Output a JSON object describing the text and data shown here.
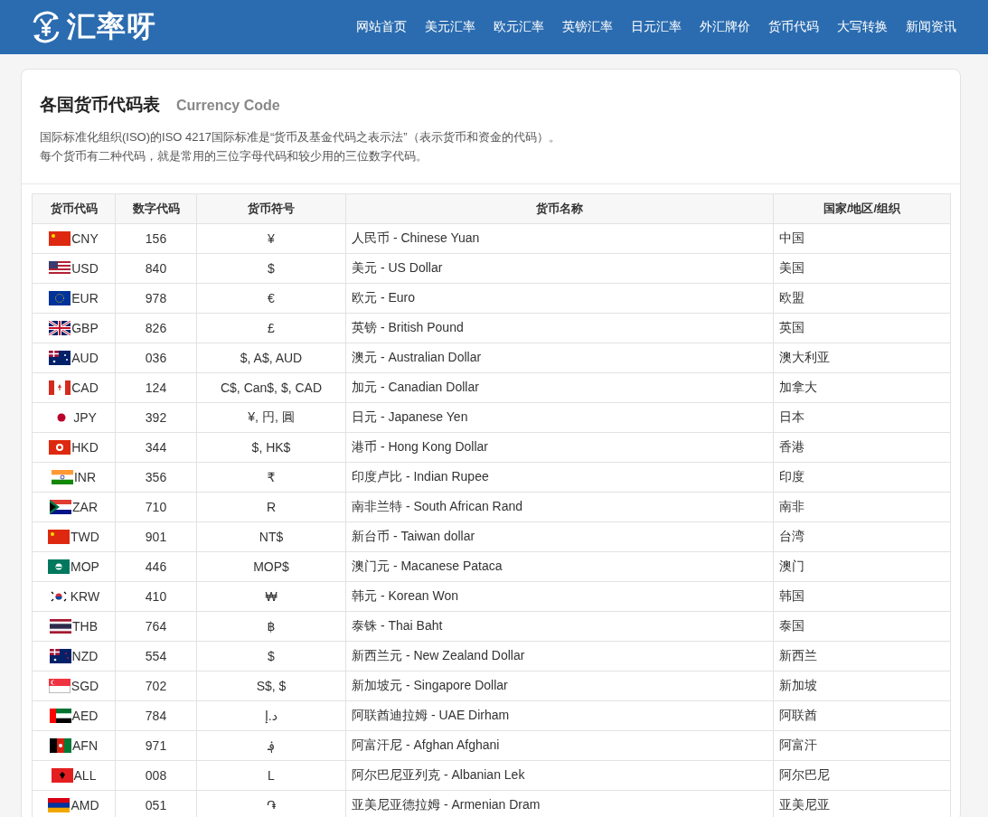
{
  "header": {
    "logo_text": "汇率呀",
    "nav": [
      {
        "label": "网站首页",
        "selected": false
      },
      {
        "label": "美元汇率",
        "selected": false
      },
      {
        "label": "欧元汇率",
        "selected": false
      },
      {
        "label": "英镑汇率",
        "selected": false
      },
      {
        "label": "日元汇率",
        "selected": false
      },
      {
        "label": "外汇牌价",
        "selected": false
      },
      {
        "label": "货币代码",
        "selected": false
      },
      {
        "label": "大写转换",
        "selected": false
      },
      {
        "label": "新闻资讯",
        "selected": false
      }
    ]
  },
  "page": {
    "title": "各国货币代码表",
    "subtitle": "Currency Code",
    "description": [
      "国际标准化组织(ISO)的ISO 4217国际标准是“货币及基金代码之表示法”（表示货币和资金的代码）。",
      "每个货币有二种代码，就是常用的三位字母代码和较少用的三位数字代码。"
    ]
  },
  "table": {
    "columns": [
      "货币代码",
      "数字代码",
      "货币符号",
      "货币名称",
      "国家/地区/组织"
    ],
    "rows": [
      {
        "kind": "cn",
        "code": "CNY",
        "number": "156",
        "symbol": "¥",
        "name": "人民币 - Chinese Yuan",
        "region": "中国"
      },
      {
        "kind": "us",
        "code": "USD",
        "number": "840",
        "symbol": "$",
        "name": "美元 - US Dollar",
        "region": "美国"
      },
      {
        "kind": "eu",
        "code": "EUR",
        "number": "978",
        "symbol": "€",
        "name": "欧元 - Euro",
        "region": "欧盟"
      },
      {
        "kind": "gb",
        "code": "GBP",
        "number": "826",
        "symbol": "£",
        "name": "英镑 - British Pound",
        "region": "英国"
      },
      {
        "kind": "au",
        "code": "AUD",
        "number": "036",
        "symbol": "$, A$, AUD",
        "name": "澳元 - Australian Dollar",
        "region": "澳大利亚"
      },
      {
        "kind": "ca",
        "code": "CAD",
        "number": "124",
        "symbol": "C$, Can$, $, CAD",
        "name": "加元 - Canadian Dollar",
        "region": "加拿大"
      },
      {
        "kind": "jp",
        "code": "JPY",
        "number": "392",
        "symbol": "¥, 円, 圓",
        "name": "日元 - Japanese Yen",
        "region": "日本"
      },
      {
        "kind": "hk",
        "code": "HKD",
        "number": "344",
        "symbol": "$, HK$",
        "name": "港币 - Hong Kong Dollar",
        "region": "香港"
      },
      {
        "kind": "in",
        "code": "INR",
        "number": "356",
        "symbol": "₹",
        "name": "印度卢比 - Indian Rupee",
        "region": "印度"
      },
      {
        "kind": "za",
        "code": "ZAR",
        "number": "710",
        "symbol": "R",
        "name": "南非兰特 - South African Rand",
        "region": "南非"
      },
      {
        "kind": "cn",
        "code": "TWD",
        "number": "901",
        "symbol": "NT$",
        "name": "新台币 - Taiwan dollar",
        "region": "台湾"
      },
      {
        "kind": "mo",
        "code": "MOP",
        "number": "446",
        "symbol": "MOP$",
        "name": "澳门元 - Macanese Pataca",
        "region": "澳门"
      },
      {
        "kind": "kr",
        "code": "KRW",
        "number": "410",
        "symbol": "₩",
        "name": "韩元 - Korean Won",
        "region": "韩国"
      },
      {
        "kind": "th",
        "code": "THB",
        "number": "764",
        "symbol": "฿",
        "name": "泰铢 - Thai Baht",
        "region": "泰国"
      },
      {
        "kind": "nz",
        "code": "NZD",
        "number": "554",
        "symbol": "$",
        "name": "新西兰元 - New Zealand Dollar",
        "region": "新西兰"
      },
      {
        "kind": "sg",
        "code": "SGD",
        "number": "702",
        "symbol": "S$, $",
        "name": "新加坡元 - Singapore Dollar",
        "region": "新加坡"
      },
      {
        "kind": "ae",
        "code": "AED",
        "number": "784",
        "symbol": "د.إ",
        "name": "阿联酋迪拉姆 - UAE Dirham",
        "region": "阿联酋"
      },
      {
        "kind": "af",
        "code": "AFN",
        "number": "971",
        "symbol": "؋",
        "name": "阿富汗尼 - Afghan Afghani",
        "region": "阿富汗"
      },
      {
        "kind": "al",
        "code": "ALL",
        "number": "008",
        "symbol": "L",
        "name": "阿尔巴尼亚列克 - Albanian Lek",
        "region": "阿尔巴尼"
      },
      {
        "kind": "am",
        "code": "AMD",
        "number": "051",
        "symbol": "֏",
        "name": "亚美尼亚德拉姆 - Armenian Dram",
        "region": "亚美尼亚"
      }
    ]
  }
}
